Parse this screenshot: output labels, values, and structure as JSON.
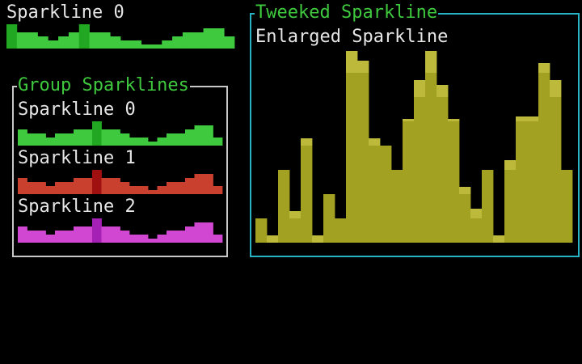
{
  "top_sparkline": {
    "label": "Sparkline 0",
    "color": "#3ec93e",
    "highlight_color": "#22a722",
    "values": [
      3,
      2,
      2,
      1.5,
      1,
      1.5,
      2,
      3,
      2,
      2,
      1.5,
      1,
      1,
      0.5,
      0.5,
      1,
      1.5,
      2,
      2,
      2.5,
      2.5,
      1.5
    ],
    "highlight_indices": [
      0,
      7
    ]
  },
  "group_panel": {
    "title": "Group Sparklines",
    "border_color": "#c8c8c8",
    "title_color": "#3ec93e",
    "sparklines": [
      {
        "label": "Sparkline 0",
        "color": "#3ec93e",
        "highlight_color": "#22a722",
        "values": [
          2,
          1.5,
          1.5,
          1,
          1.5,
          1.5,
          2,
          2,
          3,
          2,
          2,
          1.5,
          1,
          1,
          0.5,
          1,
          1.5,
          1.5,
          2,
          2.5,
          2.5,
          1
        ],
        "highlight_indices": [
          8
        ]
      },
      {
        "label": "Sparkline 1",
        "color": "#c9402f",
        "highlight_color": "#a01010",
        "values": [
          2,
          1.5,
          1.5,
          1,
          1.5,
          1.5,
          2,
          2,
          3,
          2,
          2,
          1.5,
          1,
          1,
          0.5,
          1,
          1.5,
          1.5,
          2,
          2.5,
          2.5,
          1
        ],
        "highlight_indices": [
          8
        ]
      },
      {
        "label": "Sparkline 2",
        "color": "#d147d1",
        "highlight_color": "#a520b4",
        "values": [
          2,
          1.5,
          1.5,
          1,
          1.5,
          1.5,
          2,
          2,
          3,
          2,
          2,
          1.5,
          1,
          1,
          0.5,
          1,
          1.5,
          1.5,
          2,
          2.5,
          2.5,
          1
        ],
        "highlight_indices": [
          8
        ]
      }
    ]
  },
  "tweeked_panel": {
    "title": "Tweeked Sparkline",
    "subtitle": "Enlarged Sparkline",
    "border_color": "#27b3c4",
    "title_color": "#3ec93e",
    "bar_color": "#a3a122",
    "bar_light": "#bdb93a",
    "values": [
      1,
      0.3,
      3,
      1.3,
      4.3,
      0.3,
      2,
      1,
      7.9,
      7.5,
      4.3,
      4,
      3,
      5.1,
      6.7,
      7.9,
      6.5,
      5.1,
      2.3,
      1.4,
      3,
      0.3,
      3.4,
      5.2,
      5.2,
      7.4,
      6.7,
      3
    ]
  }
}
